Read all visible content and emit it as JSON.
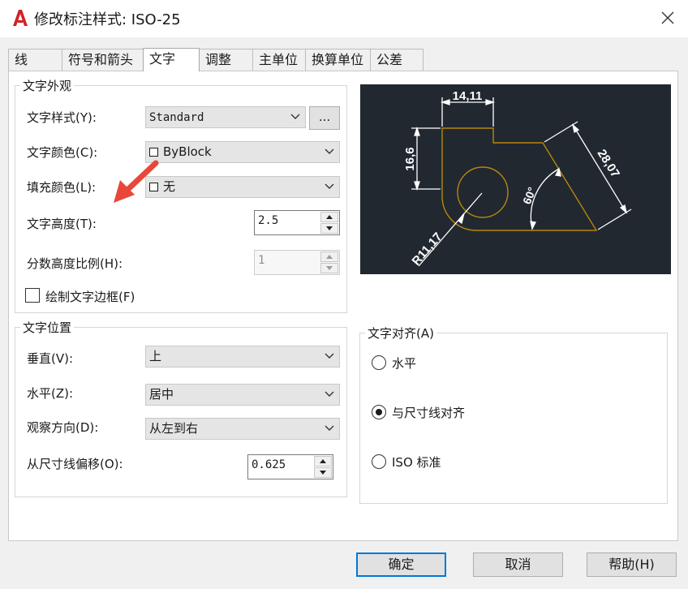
{
  "window": {
    "title": "修改标注样式: ISO-25",
    "app_icon": "autocad-a-icon",
    "close_icon": "close-icon"
  },
  "tabs": [
    {
      "label": "线"
    },
    {
      "label": "符号和箭头"
    },
    {
      "label": "文字",
      "active": true
    },
    {
      "label": "调整"
    },
    {
      "label": "主单位"
    },
    {
      "label": "换算单位"
    },
    {
      "label": "公差"
    }
  ],
  "text_appearance": {
    "legend": "文字外观",
    "style_label": "文字样式(Y):",
    "style_value": "Standard",
    "style_browse_label": "...",
    "color_label": "文字颜色(C):",
    "color_value": "ByBlock",
    "fill_label": "填充颜色(L):",
    "fill_value": "无",
    "height_label": "文字高度(T):",
    "height_value": "2.5",
    "fraction_label": "分数高度比例(H):",
    "fraction_value": "1",
    "frame_label": "绘制文字边框(F)",
    "frame_checked": false
  },
  "text_placement": {
    "legend": "文字位置",
    "vertical_label": "垂直(V):",
    "vertical_value": "上",
    "horizontal_label": "水平(Z):",
    "horizontal_value": "居中",
    "direction_label": "观察方向(D):",
    "direction_value": "从左到右",
    "offset_label": "从尺寸线偏移(O):",
    "offset_value": "0.625"
  },
  "text_alignment": {
    "legend": "文字对齐(A)",
    "options": [
      {
        "label": "水平",
        "selected": false
      },
      {
        "label": "与尺寸线对齐",
        "selected": true
      },
      {
        "label": "ISO 标准",
        "selected": false
      }
    ]
  },
  "preview": {
    "dim_top": "14,11",
    "dim_left": "16,6",
    "dim_right": "28,07",
    "dim_angle": "60°",
    "dim_radius": "R11,17",
    "background_color": "#212830",
    "geometry_color": "#b8860b",
    "dimension_color": "#ffffff"
  },
  "buttons": {
    "ok": "确定",
    "cancel": "取消",
    "help": "帮助(H)"
  },
  "annotation": {
    "arrow_color": "#e8473a"
  }
}
